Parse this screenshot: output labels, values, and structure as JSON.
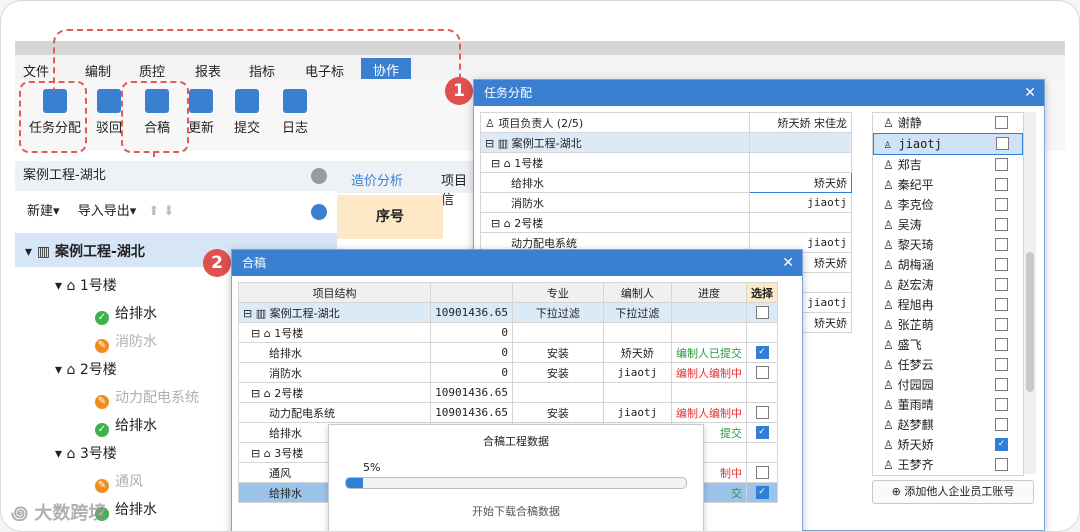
{
  "menu": {
    "items": [
      "文件",
      "编制",
      "质控",
      "报表",
      "指标",
      "电子标"
    ],
    "active": "协作"
  },
  "toolbar": {
    "buttons": [
      "任务分配",
      "驳回",
      "合稿",
      "更新",
      "提交",
      "日志"
    ]
  },
  "callouts": [
    "1",
    "2"
  ],
  "left_panel": {
    "title": "案例工程-湖北",
    "actions": [
      "新建",
      "导入导出"
    ],
    "tree": [
      {
        "label": "案例工程-湖北"
      },
      {
        "label": "1号楼"
      },
      {
        "label": "给排水",
        "status": "green"
      },
      {
        "label": "消防水",
        "status": "orange",
        "faded": true
      },
      {
        "label": "2号楼"
      },
      {
        "label": "动力配电系统",
        "status": "orange",
        "faded": true
      },
      {
        "label": "给排水",
        "status": "green"
      },
      {
        "label": "3号楼"
      },
      {
        "label": "通风",
        "status": "orange",
        "faded": true
      },
      {
        "label": "给排水",
        "status": "green"
      }
    ]
  },
  "mid_tabs": [
    "造价分析",
    "项目信"
  ],
  "mid_header": "序号",
  "task_dialog": {
    "title": "任务分配",
    "rows": [
      {
        "name": "项目负责人 (2/5)",
        "value": "矫天娇 宋佳龙"
      },
      {
        "name": "案例工程-湖北",
        "value": ""
      },
      {
        "name": "1号楼",
        "value": ""
      },
      {
        "name": "给排水",
        "value": "矫天娇"
      },
      {
        "name": "消防水",
        "value": "jiaotj"
      },
      {
        "name": "2号楼",
        "value": ""
      },
      {
        "name": "动力配电系统",
        "value": "jiaotj"
      },
      {
        "name": "",
        "value": "矫天娇"
      },
      {
        "name": "",
        "value": ""
      },
      {
        "name": "",
        "value": "jiaotj"
      },
      {
        "name": "",
        "value": "矫天娇"
      }
    ],
    "people": [
      "谢静",
      "jiaotj",
      "郑吉",
      "秦纪平",
      "李克俭",
      "吴涛",
      "黎天琦",
      "胡梅涵",
      "赵宏涛",
      "程旭冉",
      "张芷萌",
      "盛飞",
      "任梦云",
      "付园园",
      "董雨晴",
      "赵梦麒",
      "矫天娇",
      "王梦齐"
    ],
    "checked": [
      "矫天娇"
    ],
    "add_button": "添加他人企业员工账号"
  },
  "merge_dialog": {
    "title": "合稿",
    "headers": [
      "项目结构",
      "",
      "专业",
      "编制人",
      "进度",
      "选择"
    ],
    "rows": [
      {
        "name": "案例工程-湖北",
        "amount": "10901436.65",
        "major": "下拉过滤",
        "editor": "下拉过滤",
        "progress": "",
        "chk": "none"
      },
      {
        "name": "1号楼",
        "amount": "0",
        "major": "",
        "editor": "",
        "progress": "",
        "chk": ""
      },
      {
        "name": "给排水",
        "amount": "0",
        "major": "安装",
        "editor": "矫天娇",
        "progress": "编制人已提交",
        "chk": "on"
      },
      {
        "name": "消防水",
        "amount": "0",
        "major": "安装",
        "editor": "jiaotj",
        "progress": "编制人编制中",
        "chk": "off"
      },
      {
        "name": "2号楼",
        "amount": "10901436.65",
        "major": "",
        "editor": "",
        "progress": "",
        "chk": ""
      },
      {
        "name": "动力配电系统",
        "amount": "10901436.65",
        "major": "安装",
        "editor": "jiaotj",
        "progress": "编制人编制中",
        "chk": "off"
      },
      {
        "name": "给排水",
        "amount": "",
        "major": "",
        "editor": "",
        "progress": "提交",
        "chk": "on"
      },
      {
        "name": "3号楼",
        "amount": "",
        "major": "",
        "editor": "",
        "progress": "",
        "chk": ""
      },
      {
        "name": "通风",
        "amount": "",
        "major": "",
        "editor": "",
        "progress": "制中",
        "chk": "off"
      },
      {
        "name": "给排水",
        "amount": "",
        "major": "",
        "editor": "",
        "progress": "交",
        "chk": "on"
      }
    ]
  },
  "progress_popup": {
    "title": "合稿工程数据",
    "percent": "5%",
    "progress_value": 0.05,
    "status": "开始下载合稿数据"
  },
  "watermark": "大数跨境",
  "colors": {
    "accent": "#3b7fd0",
    "callout": "#e0504e"
  }
}
